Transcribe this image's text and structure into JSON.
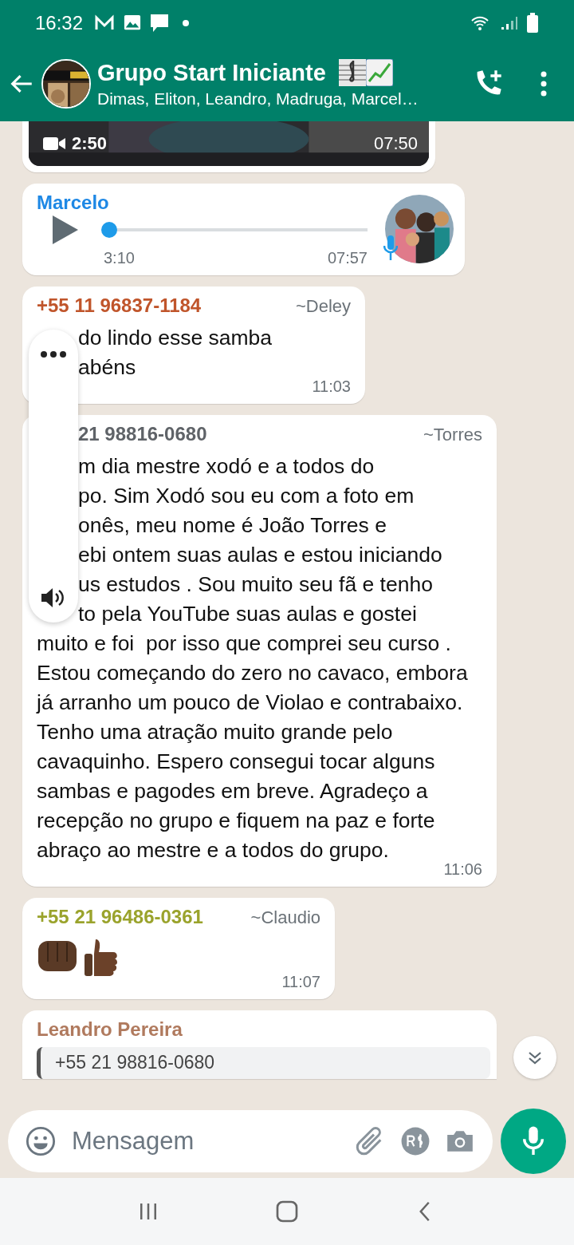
{
  "status_bar": {
    "time": "16:32"
  },
  "header": {
    "title": "Grupo Start Iniciante",
    "subtitle": "Dimas, Eliton, Leandro, Madruga, Marcel…"
  },
  "messages": [
    {
      "kind": "video",
      "duration": "2:50",
      "time": "07:50"
    },
    {
      "kind": "audio",
      "sender": "Marcelo",
      "color": "#1e88e5",
      "level": 0.02,
      "position": "3:10",
      "time": "07:57"
    },
    {
      "kind": "text",
      "sender": "+55 11 96837-1184",
      "color": "#c0552b",
      "alias": "~Deley",
      "partial_lines": [
        "do lindo esse samba",
        "abéns"
      ],
      "time": "11:03"
    },
    {
      "kind": "text",
      "sender": "21 98816-0680",
      "color": "#5f6368",
      "alias": "~Torres",
      "partial_lines": [
        "m dia mestre  xodó  e a todos do",
        "po. Sim Xodó sou eu com a foto em",
        "onês, meu nome é João Torres e",
        "ebi ontem suas aulas e estou iniciando",
        "us estudos . Sou muito seu fã e tenho",
        "to pela YouTube suas aulas e gostei"
      ],
      "text": "muito e foi  por isso que comprei seu curso . Estou começando do zero no cavaco, embora já arranho um pouco de Violao e contrabaixo. Tenho uma atração muito grande pelo cavaquinho. Espero consegui tocar alguns sambas e pagodes em breve. Agradeço a recepção no grupo e fiquem na paz e forte abraço ao mestre e a todos do grupo.",
      "time": "11:06"
    },
    {
      "kind": "emoji",
      "sender": "+55 21 96486-0361",
      "color": "#9aa32c",
      "alias": "~Claudio",
      "time": "11:07"
    },
    {
      "kind": "reply",
      "sender": "Leandro Pereira",
      "color": "#b07a5e",
      "quote_sender": "+55 21 98816-0680"
    }
  ],
  "composer": {
    "placeholder": "Mensagem"
  }
}
